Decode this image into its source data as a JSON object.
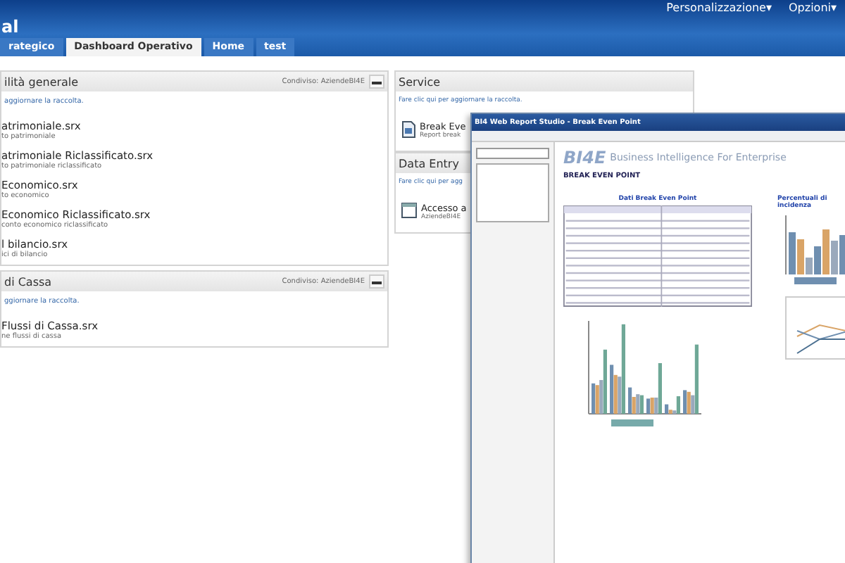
{
  "header": {
    "title": "al",
    "menus": [
      "Personalizzazione▾",
      "Opzioni▾"
    ]
  },
  "tabs": [
    {
      "label": "rategico",
      "selected": false
    },
    {
      "label": "Dashboard Operativo",
      "selected": true
    },
    {
      "label": "Home",
      "selected": false
    },
    {
      "label": "test",
      "selected": false
    }
  ],
  "left_panels": [
    {
      "title": "ilità generale",
      "shared": "Condiviso: AziendeBI4E",
      "refresh": "aggiornare la raccolta.",
      "items": [
        {
          "name": "atrimoniale.srx",
          "description": "to patrimoniale"
        },
        {
          "name": "atrimoniale Riclassificato.srx",
          "description": "to patrimoniale riclassificato"
        },
        {
          "name": "Economico.srx",
          "description": "to economico"
        },
        {
          "name": "Economico Riclassificato.srx",
          "description": "conto economico riclassificato"
        },
        {
          "name": "l bilancio.srx",
          "description": "ici di bilancio"
        }
      ]
    },
    {
      "title": "di Cassa",
      "shared": "Condiviso: AziendeBI4E",
      "refresh": "ggiornare la raccolta.",
      "items": [
        {
          "name": "Flussi di Cassa.srx",
          "description": "ne flussi di cassa"
        }
      ]
    }
  ],
  "right_panels": [
    {
      "title": "Service",
      "refresh": "Fare clic qui per aggiornare la raccolta.",
      "item": {
        "kind": "report",
        "name": "Break Eve",
        "description": "Report break"
      }
    },
    {
      "title": "Data Entry",
      "refresh": "Fare clic qui per agg",
      "item": {
        "kind": "form",
        "name": "Accesso a",
        "description": "AziendeBI4E"
      }
    }
  ],
  "report_window": {
    "title": "BI4 Web Report Studio - Break Even Point",
    "logo": "BI4E",
    "tagline": "Business Intelligence For Enterprise",
    "report_title": "BREAK EVEN POINT",
    "table_title": "Dati Break Even Point",
    "chart_title": "Percentuali di incidenza"
  }
}
